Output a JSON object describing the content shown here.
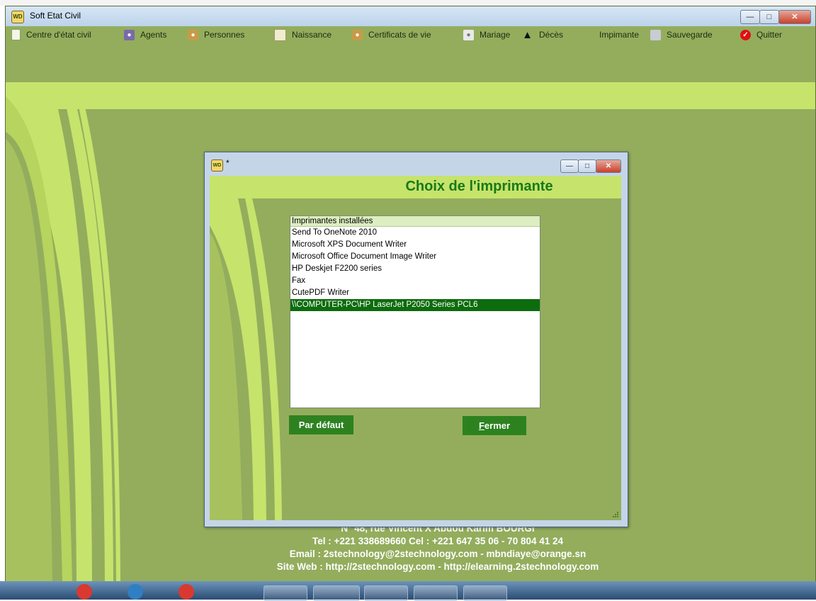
{
  "app": {
    "title": "Soft Etat Civil"
  },
  "menu": [
    {
      "label": "Centre d'état civil",
      "icon": "page-icon"
    },
    {
      "label": "Agents",
      "icon": "agent-icon"
    },
    {
      "label": "Personnes",
      "icon": "people-icon"
    },
    {
      "label": "Naissance",
      "icon": "notebook-icon"
    },
    {
      "label": "Certificats de vie",
      "icon": "people-icon"
    },
    {
      "label": "Mariage",
      "icon": "couple-icon"
    },
    {
      "label": "Décès",
      "icon": "coffin-icon"
    },
    {
      "label": "Impimante",
      "icon": "none"
    },
    {
      "label": "Sauvegarde",
      "icon": "backup-icon"
    },
    {
      "label": "Quitter",
      "icon": "check-red-icon"
    }
  ],
  "footer": {
    "address": "N° 48, rue Vincent X Abdou Karim BOURGI",
    "phone": "Tel : +221 338689660 Cel : +221 647 35 06 - 70 804 41 24",
    "email": "Email : 2stechnology@2stechnology.com - mbndiaye@orange.sn",
    "website": "Site Web : http://2stechnology.com - http://elearning.2stechnology.com"
  },
  "dialog": {
    "title": "*",
    "heading": "Choix de l'imprimante",
    "list_header": "Imprimantes installées",
    "printers": [
      "Send To OneNote 2010",
      "Microsoft XPS Document Writer",
      "Microsoft Office Document Image Writer",
      "HP Deskjet F2200 series",
      "Fax",
      "CutePDF Writer",
      "\\\\COMPUTER-PC\\HP LaserJet P2050 Series PCL6"
    ],
    "selected_index": 6,
    "default_button": "Par défaut",
    "close_button_underlined": "F",
    "close_button_rest": "ermer"
  },
  "colors": {
    "background_green": "#93ad5d",
    "light_green": "#c6e36c",
    "button_green": "#2d821f",
    "selection_green": "#0d6c0d",
    "heading_green": "#177a17"
  }
}
